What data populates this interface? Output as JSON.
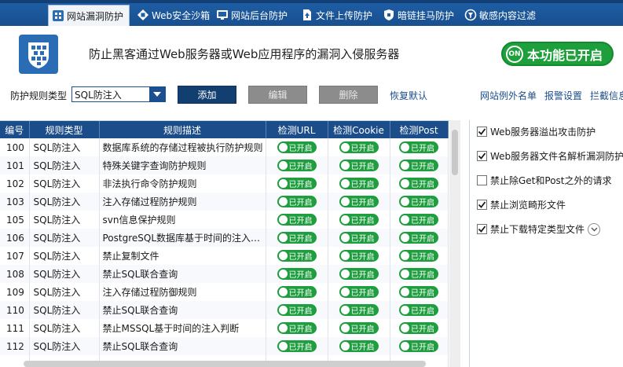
{
  "tabs": [
    {
      "label": "网站漏洞防护",
      "icon": "shield-grid-icon",
      "active": true
    },
    {
      "label": "Web安全沙箱",
      "icon": "sandbox-icon",
      "active": false
    },
    {
      "label": "网站后台防护",
      "icon": "backend-monitor-icon",
      "active": false
    },
    {
      "label": "文件上传防护",
      "icon": "file-upload-icon",
      "active": false
    },
    {
      "label": "暗链挂马防护",
      "icon": "dark-link-icon",
      "active": false
    },
    {
      "label": "敏感内容过滤",
      "icon": "content-filter-icon",
      "active": false
    }
  ],
  "header": {
    "logo_icon": "shield-grid-logo-icon",
    "description": "防止黑客通过Web服务器或Web应用程序的漏洞入侵服务器",
    "status_button": {
      "circle_text": "ON",
      "label": "本功能已开启"
    }
  },
  "toolbar": {
    "rule_type_label": "防护规则类型",
    "rule_type_value": "SQL防注入",
    "add_label": "添加",
    "edit_label": "编辑",
    "delete_label": "删除",
    "restore_label": "恢复默认",
    "links": [
      "网站例外名单",
      "报警设置",
      "拦截信息"
    ]
  },
  "table": {
    "columns": [
      "编号",
      "规则类型",
      "规则描述",
      "检测URL",
      "检测Cookie",
      "检测Post"
    ],
    "toggle_label": "已开启",
    "rows": [
      {
        "id": "100",
        "type": "SQL防注入",
        "desc": "数据库系统的存储过程被执行防护规则"
      },
      {
        "id": "101",
        "type": "SQL防注入",
        "desc": "特殊关键字查询防护规则"
      },
      {
        "id": "102",
        "type": "SQL防注入",
        "desc": "非法执行命令防护规则"
      },
      {
        "id": "103",
        "type": "SQL防注入",
        "desc": "注入存储过程防护规则"
      },
      {
        "id": "105",
        "type": "SQL防注入",
        "desc": "svn信息保护规则"
      },
      {
        "id": "106",
        "type": "SQL防注入",
        "desc": "PostgreSQL数据库基于时间的注入判断"
      },
      {
        "id": "107",
        "type": "SQL防注入",
        "desc": "禁止复制文件"
      },
      {
        "id": "108",
        "type": "SQL防注入",
        "desc": "禁止SQL联合查询"
      },
      {
        "id": "109",
        "type": "SQL防注入",
        "desc": "注入存储过程防御规则"
      },
      {
        "id": "110",
        "type": "SQL防注入",
        "desc": "禁止SQL联合查询"
      },
      {
        "id": "111",
        "type": "SQL防注入",
        "desc": "禁止MSSQL基于时间的注入判断"
      },
      {
        "id": "112",
        "type": "SQL防注入",
        "desc": "禁止SQL联合查询"
      },
      {
        "id": "",
        "type": "",
        "desc": ""
      }
    ]
  },
  "options": [
    {
      "label": "Web服务器溢出攻击防护",
      "checked": true
    },
    {
      "label": "Web服务器文件名解析漏洞防护",
      "checked": true
    },
    {
      "label": "禁止除Get和Post之外的请求",
      "checked": false
    },
    {
      "label": "禁止浏览畸形文件",
      "checked": true
    },
    {
      "label": "禁止下载特定类型文件",
      "checked": true
    }
  ],
  "colors": {
    "tab_bar": "#1f5fa6",
    "header_bg": "#1b4d8a",
    "toggle_green": "#1e9e3e",
    "primary_button": "#123f70",
    "disabled_button": "#8c8c8c"
  }
}
